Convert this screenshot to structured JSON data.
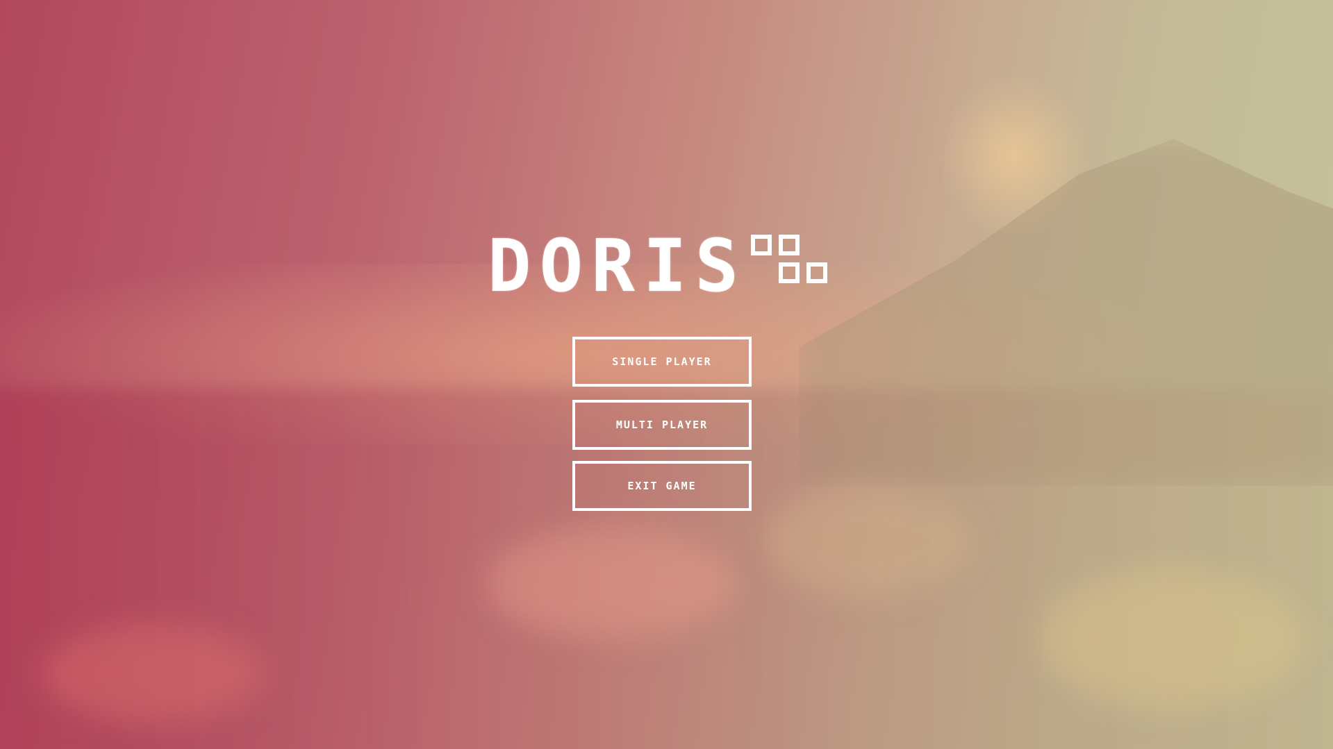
{
  "game": {
    "title": "DORIS",
    "logo_icon": "four-squares-icon"
  },
  "menu": {
    "single_player": "SINGLE PLAYER",
    "multi_player": "MULTI PLAYER",
    "exit_game": "EXIT GAME"
  },
  "colors": {
    "ui_foreground": "#ffffff",
    "background_left": "#b2485d",
    "background_right": "#c4c29c"
  }
}
